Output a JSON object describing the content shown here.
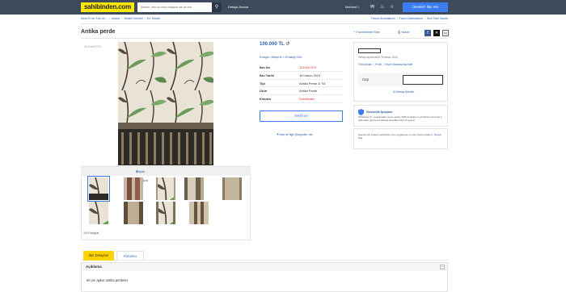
{
  "header": {
    "logo": "sahibinden.com",
    "search_placeholder": "Kelime, ilan no veya mağaza adı ile ara",
    "advanced_search": "Detaylı Arama",
    "user_name": "Mehmet I.",
    "sell_button": "Ücretsiz* İlan Ver"
  },
  "breadcrumbs": [
    "İkinci El ve Sıfır Alı...",
    "Antika",
    "Tekstil Ürünleri",
    "Ev Tekstili"
  ],
  "right_links": [
    "Favori Aramalarım",
    "Favori Aramalarım",
    "Size Özel İlanlar"
  ],
  "listing": {
    "title": "Antika perde",
    "ad_number": "#1211467379",
    "price": "100.000 TL",
    "location": [
      "Konya",
      "Akşehir",
      "Ortaköy Mh."
    ],
    "details": [
      {
        "key": "İlan No",
        "value": "1211467379",
        "highlight": "#dd3333"
      },
      {
        "key": "İlan Tarihi",
        "value": "16 Kasım 2024"
      },
      {
        "key": "Tipi",
        "value": "Antika Perde & Tül"
      },
      {
        "key": "Ürün",
        "value": "Antika Perde"
      },
      {
        "key": "Kimden",
        "value": "Sahibinden",
        "highlight": "#dd3333"
      }
    ],
    "offer_button": "Teklif ver",
    "report_link": "İlan ile İlgili Şikayetim Var",
    "favorite_link": "Favorilerime Ekle",
    "print_link": "Yazdır"
  },
  "gallery": {
    "big_photo_label": "Büyük Fotoğraf",
    "photo_count": "1/9 Fotoğraf",
    "thumbnail_count": 9
  },
  "seller": {
    "member_since": "Hesap açma tarihi: Temmuz 2024",
    "links": [
      "Tüm İlanları",
      "Profil",
      "Favori Satıcılarıma ekle"
    ],
    "phone_label": "Cep",
    "message_link": "Mesaj Gönder"
  },
  "safety": {
    "title": "Güvenlik İpuçları",
    "text": "WhatsApp vb. uygulamalar veya e-posta, SMS ile iletilen ve S-Param Güvende'yi taklit eden gayriresmi linklere kesinlikle itibar etmeyiniz.",
    "text2": "İşlemlerinizi sadece sahibinden.com uygulaması ve web sitesini kullanın.",
    "detail_link": "Detaylı bilgi"
  },
  "tabs": [
    "İlan Detayları",
    "Konumu"
  ],
  "description": {
    "heading": "Açıklama",
    "body": "60 yılı aşkın antika perdeler"
  },
  "colors": {
    "header_bg": "#3d4a5c",
    "logo_yellow": "#ffe800",
    "link_blue": "#2a5ea7",
    "button_blue": "#3b7cf0",
    "tab_yellow": "#ffd200"
  }
}
